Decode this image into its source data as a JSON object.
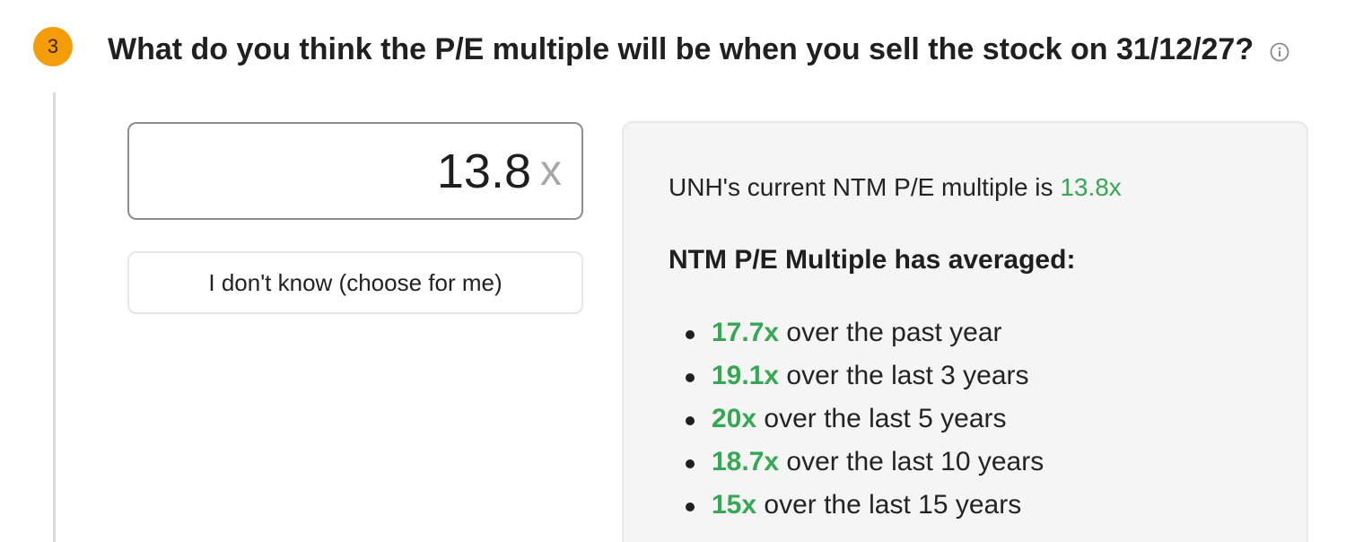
{
  "step": {
    "number": "3",
    "badge_color": "#f59c0b",
    "question": "What do you think the P/E multiple will be when you sell the stock on 31/12/27?",
    "info_icon": "info-circle-icon"
  },
  "input": {
    "value": "13.8",
    "suffix": "x"
  },
  "dont_know_button": {
    "label": "I don't know (choose for me)"
  },
  "panel": {
    "current_prefix": "UNH's current NTM P/E multiple is ",
    "current_value": "13.8x",
    "averages_heading": "NTM P/E Multiple has averaged:",
    "averages": [
      {
        "value": "17.7x",
        "text": " over the past year"
      },
      {
        "value": "19.1x",
        "text": " over the last 3 years"
      },
      {
        "value": "20x",
        "text": " over the last 5 years"
      },
      {
        "value": "18.7x",
        "text": " over the last 10 years"
      },
      {
        "value": "15x",
        "text": " over the last 15 years"
      }
    ],
    "accent_color": "#34a853"
  }
}
